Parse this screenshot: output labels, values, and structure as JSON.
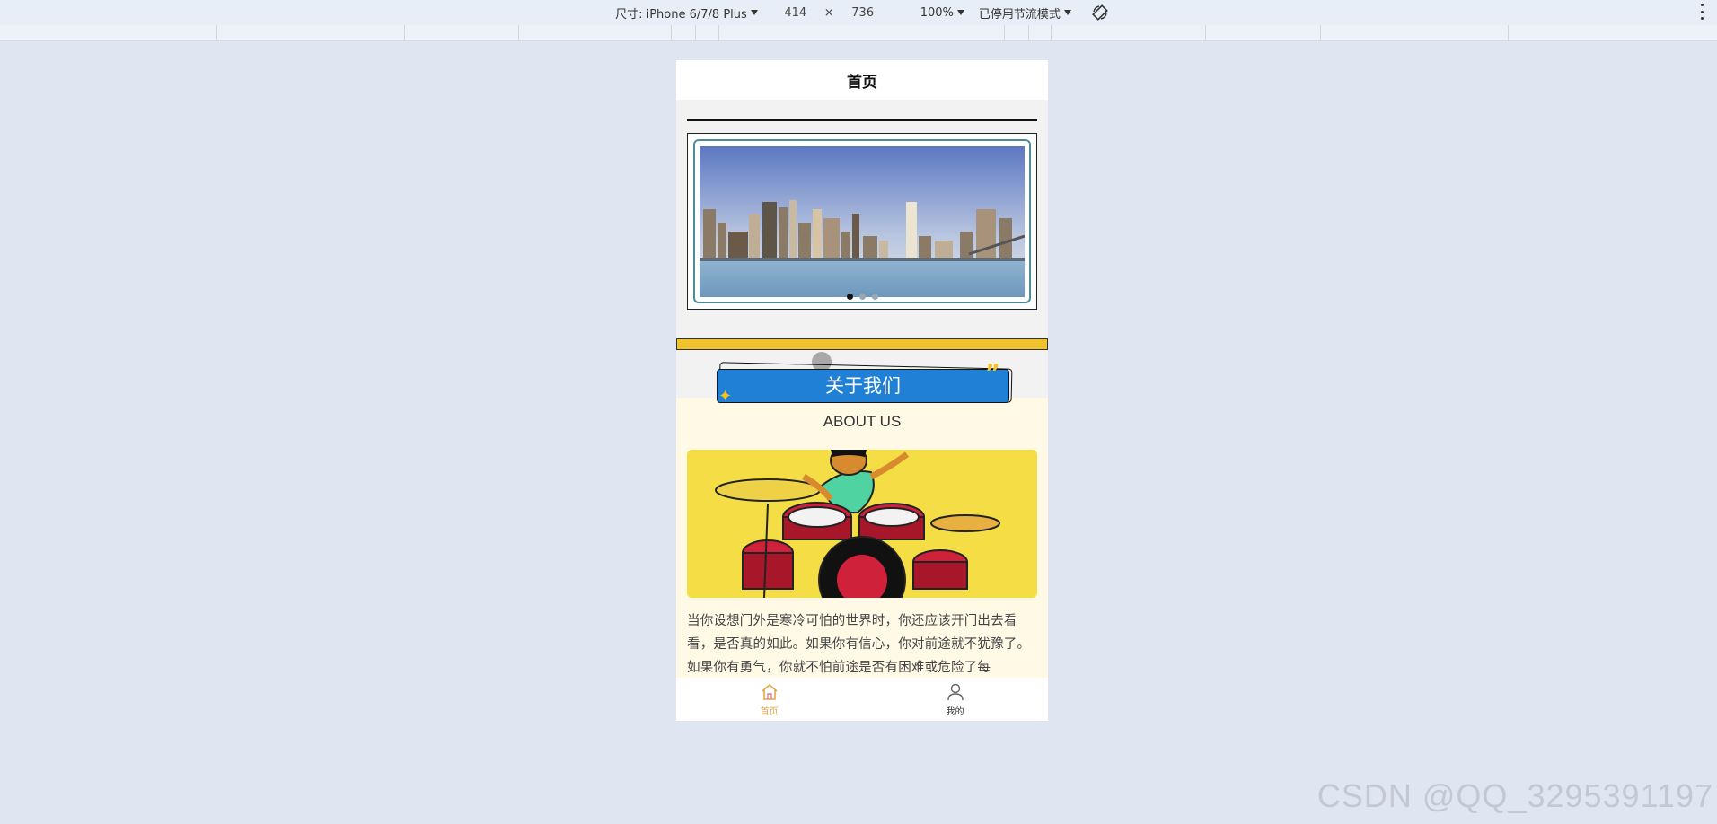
{
  "devtools": {
    "size_label": "尺寸: iPhone 6/7/8 Plus",
    "width": "414",
    "times": "×",
    "height": "736",
    "zoom": "100%",
    "throttle": "已停用节流模式"
  },
  "page": {
    "nav_title": "首页",
    "swiper_dots_count": 3,
    "swiper_active_index": 0,
    "about_title": "关于我们",
    "about_subtitle": "ABOUT US",
    "about_paragraph": "当你设想门外是寒冷可怕的世界时，你还应该开门出去看看，是否真的如此。如果你有信心，你对前途就不犹豫了。如果你有勇气，你就不怕前途是否有困难或危险了每",
    "quote_glyph": "”",
    "star_glyph": "✦"
  },
  "tabbar": {
    "tabs": [
      {
        "label": "首页",
        "icon": "home-icon",
        "active": true
      },
      {
        "label": "我的",
        "icon": "user-icon",
        "active": false
      }
    ]
  },
  "colors": {
    "accent_blue": "#1f80d6",
    "accent_yellow": "#f2c12e",
    "tab_active": "#e3a64b"
  },
  "watermark": "CSDN @QQ_3295391197"
}
